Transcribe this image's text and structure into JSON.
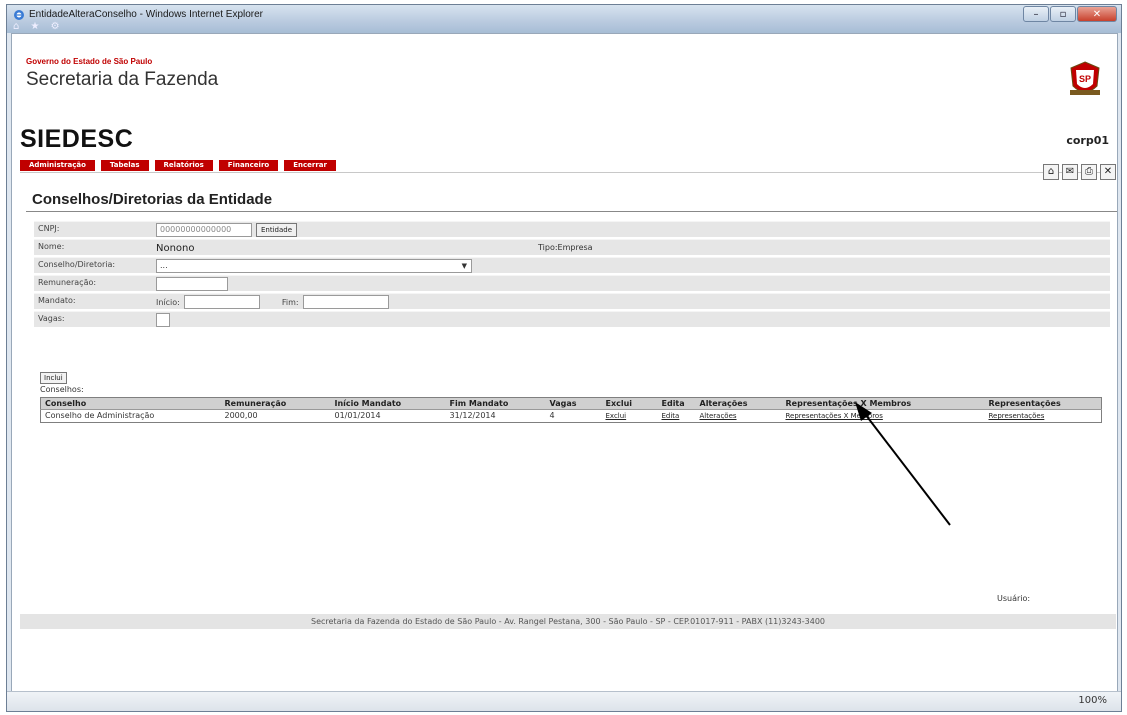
{
  "window": {
    "title": "EntidadeAlteraConselho - Windows Internet Explorer",
    "nav_icons": "⌂ ★ ⚙",
    "min": "–",
    "max": "▫",
    "close": "✕"
  },
  "header": {
    "gov_line": "Governo do Estado de São Paulo",
    "secretaria": "Secretaria da Fazenda",
    "logo_text": "SP",
    "app_name": "SIEDESC",
    "user_code": "corp01"
  },
  "menu": [
    {
      "label": "Administração"
    },
    {
      "label": "Tabelas"
    },
    {
      "label": "Relatórios"
    },
    {
      "label": "Financeiro"
    },
    {
      "label": "Encerrar"
    }
  ],
  "tools": {
    "home": "⌂",
    "mail": "✉",
    "print": "⎙",
    "close": "✕"
  },
  "page_title": "Conselhos/Diretorias da Entidade",
  "form": {
    "cnpj_label": "CNPJ:",
    "cnpj_value": "00000000000000",
    "entidade_btn": "Entidade",
    "nome_label": "Nome:",
    "nome_value": "Nonono",
    "tipo": "Tipo:Empresa",
    "conselho_label": "Conselho/Diretoria:",
    "conselho_value": "...",
    "remuneracao_label": "Remuneração:",
    "mandato_label": "Mandato:",
    "inicio_label": "Início:",
    "fim_label": "Fim:",
    "vagas_label": "Vagas:",
    "incluir": "Inclui"
  },
  "conselhos_label": "Conselhos:",
  "table": {
    "headers": [
      "Conselho",
      "Remuneração",
      "Início Mandato",
      "Fim Mandato",
      "Vagas",
      "Exclui",
      "Edita",
      "Alterações",
      "Representações X Membros",
      "Representações"
    ],
    "rows": [
      [
        "Conselho de Administração",
        "2000,00",
        "01/01/2014",
        "31/12/2014",
        "4",
        "Exclui",
        "Edita",
        "Alterações",
        "Representações X Membros",
        "Representações"
      ]
    ]
  },
  "usuario": "Usuário:",
  "footer": "Secretaria da Fazenda do Estado de São Paulo - Av. Rangel Pestana, 300 - São Paulo - SP - CEP.01017-911 - PABX (11)3243-3400",
  "status": {
    "zoom": "100%"
  }
}
